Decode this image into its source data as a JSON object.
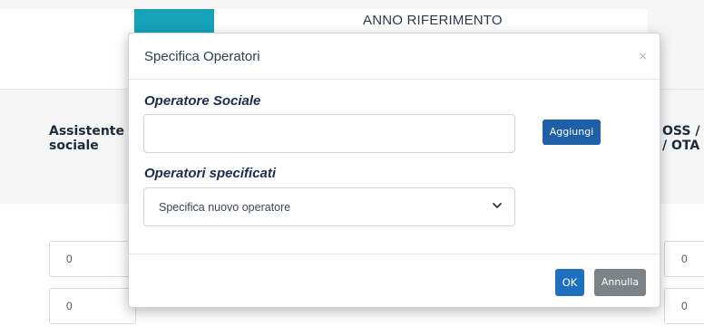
{
  "background": {
    "year_title": "ANNO RIFERIMENTO",
    "column_left": "Assistente\nsociale",
    "column_right": "OSS /\n/ OTA",
    "cells": [
      "0",
      "0",
      "0",
      "0"
    ]
  },
  "modal": {
    "title": "Specifica Operatori",
    "close_symbol": "×",
    "operator_label": "Operatore Sociale",
    "operator_input_value": "",
    "add_button": "Aggiungi",
    "specified_label": "Operatori specificati",
    "select_value": "Specifica nuovo operatore",
    "ok_button": "OK",
    "cancel_button": "Annulla"
  },
  "colors": {
    "primary": "#1f6fbf",
    "teal": "#17a2b8",
    "secondary": "#7d8387",
    "label": "#1b2d4f"
  }
}
